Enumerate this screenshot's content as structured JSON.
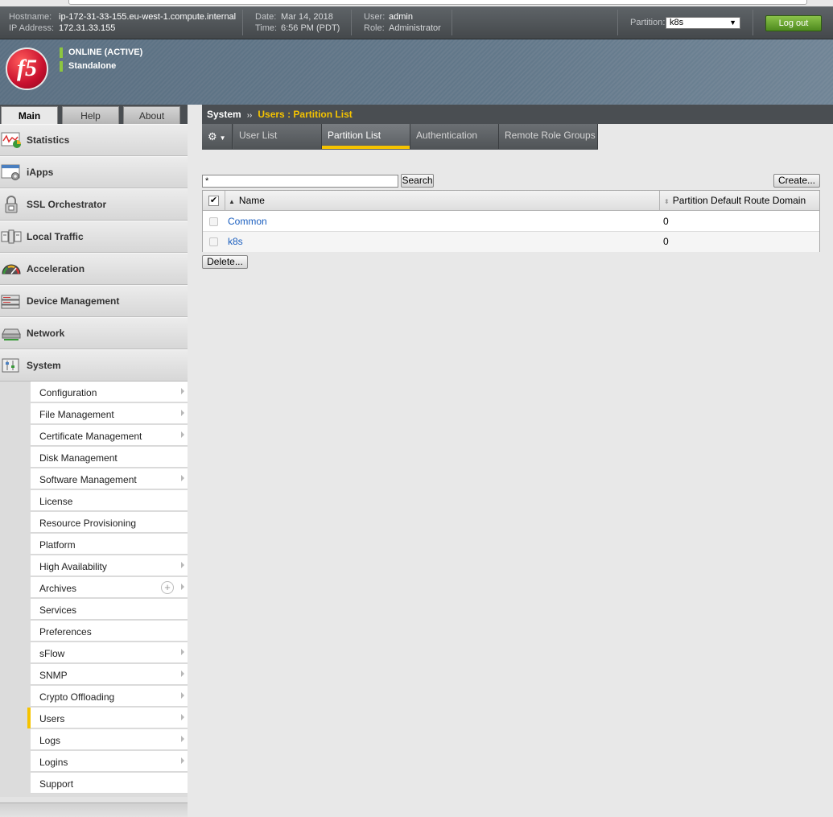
{
  "header": {
    "hostname_label": "Hostname:",
    "hostname": "ip-172-31-33-155.eu-west-1.compute.internal",
    "ip_label": "IP Address:",
    "ip": "172.31.33.155",
    "date_label": "Date:",
    "date": "Mar 14, 2018",
    "time_label": "Time:",
    "time": "6:56 PM (PDT)",
    "user_label": "User:",
    "user": "admin",
    "role_label": "Role:",
    "role": "Administrator",
    "partition_label": "Partition:",
    "partition_value": "k8s",
    "logout_label": "Log out"
  },
  "banner": {
    "logo_text": "f5",
    "status_primary": "ONLINE (ACTIVE)",
    "status_secondary": "Standalone"
  },
  "tabs": [
    "Main",
    "Help",
    "About"
  ],
  "nav": {
    "items": [
      {
        "label": "Statistics",
        "icon": "statistics-icon"
      },
      {
        "label": "iApps",
        "icon": "iapps-icon"
      },
      {
        "label": "SSL Orchestrator",
        "icon": "lock-icon"
      },
      {
        "label": "Local Traffic",
        "icon": "local-traffic-icon"
      },
      {
        "label": "Acceleration",
        "icon": "gauge-icon"
      },
      {
        "label": "Device Management",
        "icon": "device-management-icon"
      },
      {
        "label": "Network",
        "icon": "network-icon"
      },
      {
        "label": "System",
        "icon": "system-icon"
      }
    ],
    "system_submenu": [
      {
        "label": "Configuration",
        "arrow": true
      },
      {
        "label": "File Management",
        "arrow": true
      },
      {
        "label": "Certificate Management",
        "arrow": true
      },
      {
        "label": "Disk Management",
        "arrow": false
      },
      {
        "label": "Software Management",
        "arrow": true
      },
      {
        "label": "License",
        "arrow": false
      },
      {
        "label": "Resource Provisioning",
        "arrow": false
      },
      {
        "label": "Platform",
        "arrow": false
      },
      {
        "label": "High Availability",
        "arrow": true
      },
      {
        "label": "Archives",
        "arrow": true,
        "plus": true
      },
      {
        "label": "Services",
        "arrow": false
      },
      {
        "label": "Preferences",
        "arrow": false
      },
      {
        "label": "sFlow",
        "arrow": true
      },
      {
        "label": "SNMP",
        "arrow": true
      },
      {
        "label": "Crypto Offloading",
        "arrow": true
      },
      {
        "label": "Users",
        "arrow": true,
        "active": true
      },
      {
        "label": "Logs",
        "arrow": true
      },
      {
        "label": "Logins",
        "arrow": true
      },
      {
        "label": "Support",
        "arrow": false
      }
    ]
  },
  "breadcrumb": {
    "root": "System",
    "separator": "››",
    "current": "Users : Partition List"
  },
  "subtabs": {
    "gear_icon": "gear-icon",
    "items": [
      "User List",
      "Partition List",
      "Authentication",
      "Remote Role Groups"
    ],
    "active": "Partition List"
  },
  "toolbar": {
    "search_value": "*",
    "search_button": "Search",
    "create_button": "Create...",
    "delete_button": "Delete..."
  },
  "table": {
    "columns": [
      "Name",
      "Partition Default Route Domain"
    ],
    "rows": [
      {
        "name": "Common",
        "route_domain": "0"
      },
      {
        "name": "k8s",
        "route_domain": "0"
      }
    ]
  },
  "colors": {
    "accent": "#f5c300",
    "status_green": "#8dc63f",
    "link": "#1a5ebf",
    "logout_green": "#4e8a1e"
  }
}
